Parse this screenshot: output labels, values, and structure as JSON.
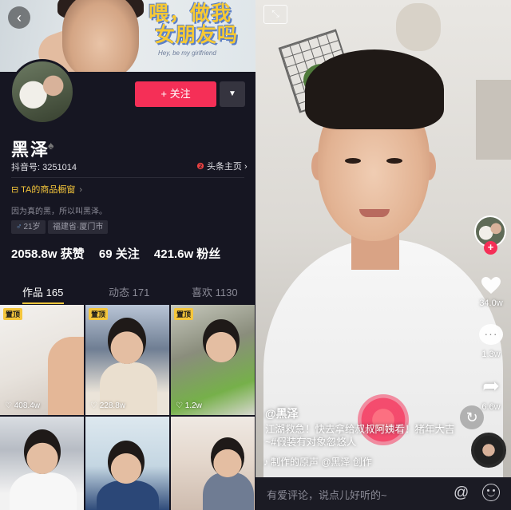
{
  "profile": {
    "banner_text_line1": "喂，做我",
    "banner_text_line2": "女朋友吗",
    "banner_sub": "Hey, be my girlfriend",
    "back_icon": "‹",
    "follow_label": "+ 关注",
    "more_icon": "▼",
    "name": "黑泽",
    "name_badge": "♠",
    "douyin_id": "抖音号: 3251014",
    "toutiao_icon": "❷",
    "toutiao_label": "头条主页 ›",
    "shop_label": "TA的商品橱窗",
    "shop_icon": "⊟",
    "bio": "因为真的黑，所以叫黑泽。",
    "age_icon": "♂",
    "age": "21岁",
    "location": "福建省·厦门市",
    "stats": {
      "likes": "2058.8w 获赞",
      "following": "69 关注",
      "fans": "421.6w 粉丝"
    },
    "tabs": [
      {
        "label": "作品 165"
      },
      {
        "label": "动态 171"
      },
      {
        "label": "喜欢 1130"
      }
    ],
    "grid": [
      {
        "pinned": "置顶",
        "likes": "♡ 408.4w"
      },
      {
        "pinned": "置顶",
        "likes": "♡ 228.8w"
      },
      {
        "pinned": "置顶",
        "likes": "♡ 1.2w"
      },
      {
        "pinned": "",
        "likes": ""
      },
      {
        "pinned": "",
        "likes": ""
      },
      {
        "pinned": "",
        "likes": ""
      }
    ]
  },
  "video": {
    "collapse_icon": "⤡",
    "heart_count": "34.0w",
    "comment_count": "1.3w",
    "share_icon": "➦",
    "share_count": "6.6w",
    "replay_icon": "↻",
    "author": "@黑泽",
    "caption": "江湖救急！快去拿给叔叔阿姨看！猪年大吉~#假装有对象忽悠人",
    "music_note": "♪",
    "music": "制作的原声   @黑泽   创作",
    "comment_placeholder": "有爱评论，说点儿好听的~",
    "at_icon": "@",
    "accent": "#f52f57",
    "pin_color": "#f5c63b"
  }
}
